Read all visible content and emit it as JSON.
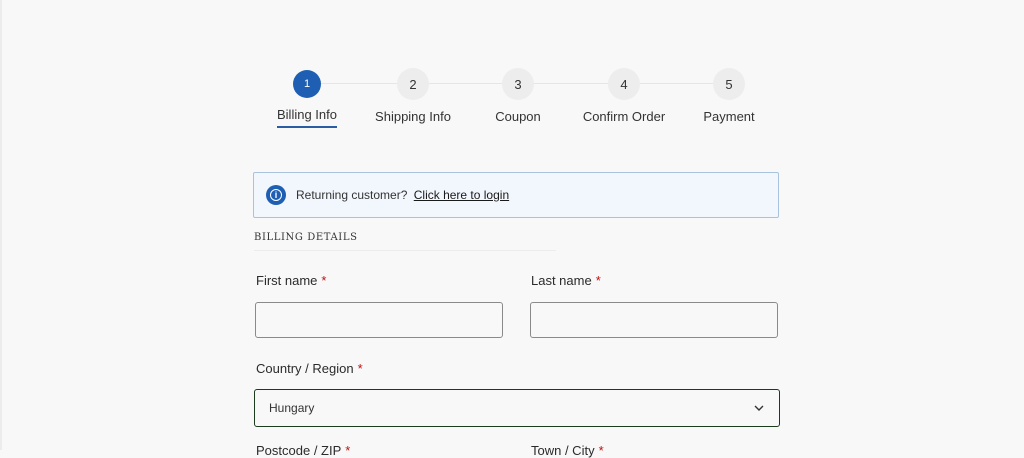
{
  "stepper": {
    "steps": [
      {
        "number": "1",
        "label": "Billing Info",
        "active": true
      },
      {
        "number": "2",
        "label": "Shipping Info",
        "active": false
      },
      {
        "number": "3",
        "label": "Coupon",
        "active": false
      },
      {
        "number": "4",
        "label": "Confirm Order",
        "active": false
      },
      {
        "number": "5",
        "label": "Payment",
        "active": false
      }
    ]
  },
  "notice": {
    "text": "Returning customer?",
    "link": "Click here to login",
    "icon": "info-icon"
  },
  "billing": {
    "section_title": "BILLING DETAILS",
    "first_name": {
      "label": "First name",
      "value": ""
    },
    "last_name": {
      "label": "Last name",
      "value": ""
    },
    "country": {
      "label": "Country / Region",
      "value": "Hungary"
    },
    "postcode": {
      "label": "Postcode / ZIP"
    },
    "city": {
      "label": "Town / City"
    },
    "required_mark": "*"
  },
  "colors": {
    "accent": "#1f5fb3",
    "required": "#bb1111",
    "notice_bg": "#f2f7fd"
  }
}
